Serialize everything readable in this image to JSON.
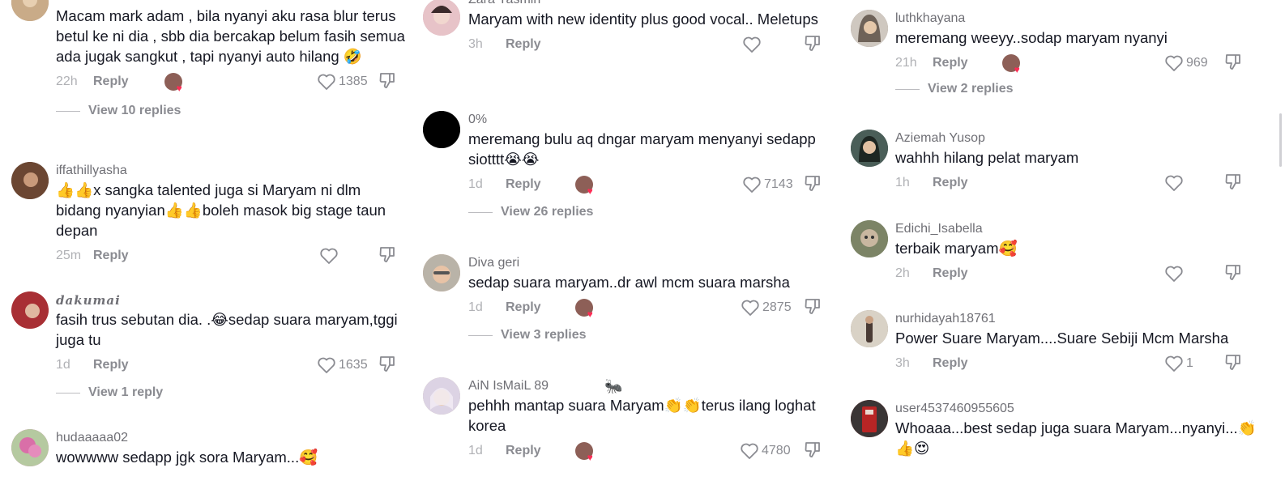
{
  "columns": [
    {
      "comments": [
        {
          "username": "",
          "text": "Macam mark adam , bila nyanyi aku rasa blur terus betul ke ni dia , sbb dia bercakap belum fasih semua ada jugak sangkut , tapi nyanyi auto hilang 🤣",
          "time": "22h",
          "reply": "Reply",
          "likes": "1385",
          "view_replies": "View 10 replies",
          "avatar_color": "#b89a78"
        },
        {
          "username": "iffathillyasha",
          "text": "👍👍x sangka talented juga si Maryam ni dlm bidang nyanyian👍👍boleh masok big stage taun depan",
          "time": "25m",
          "reply": "Reply",
          "likes": "",
          "view_replies": "",
          "avatar_color": "#5a3b2a"
        },
        {
          "username": "dakumai",
          "text": "fasih trus sebutan dia. .😂sedap suara maryam,tggi juga tu",
          "time": "1d",
          "reply": "Reply",
          "likes": "1635",
          "view_replies": "View 1 reply",
          "avatar_color": "#b03a3a"
        },
        {
          "username": "hudaaaaa02",
          "text": "wowwww sedapp jgk sora Maryam...🥰",
          "time": "",
          "reply": "",
          "likes": "",
          "view_replies": "",
          "avatar_color": "#d77fb0"
        }
      ]
    },
    {
      "comments": [
        {
          "username": "Zara Yasmin",
          "text": "Maryam with new identity plus good vocal.. Meletups",
          "time": "3h",
          "reply": "Reply",
          "likes": "",
          "view_replies": "",
          "avatar_color": "#d6a3b0"
        },
        {
          "username": "0%",
          "text": "meremang bulu aq dngar maryam menyanyi sedapp siotttt😭😭",
          "time": "1d",
          "reply": "Reply",
          "likes": "7143",
          "view_replies": "View 26 replies",
          "avatar_color": "#000000"
        },
        {
          "username": "Diva geri",
          "text": "sedap suara maryam..dr awl mcm suara marsha",
          "time": "1d",
          "reply": "Reply",
          "likes": "2875",
          "view_replies": "View 3 replies",
          "avatar_color": "#c9a28a"
        },
        {
          "username": "AiN IsMaiL 89",
          "text": "pehhh mantap suara Maryam👏👏terus ilang loghat korea",
          "time": "1d",
          "reply": "Reply",
          "likes": "4780",
          "view_replies": "",
          "avatar_color": "#c7b9ad",
          "username_emoji": "🐜"
        }
      ]
    },
    {
      "comments": [
        {
          "username": "luthkhayana",
          "text": "meremang weeyy..sodap maryam nyanyi",
          "time": "21h",
          "reply": "Reply",
          "likes": "969",
          "view_replies": "View 2 replies",
          "avatar_color": "#9c8f86"
        },
        {
          "username": "Aziemah Yusop",
          "text": "wahhh hilang pelat maryam",
          "time": "1h",
          "reply": "Reply",
          "likes": "",
          "view_replies": "",
          "avatar_color": "#2f3f3a"
        },
        {
          "username": "Edichi_Isabella",
          "text": "terbaik maryam🥰",
          "time": "2h",
          "reply": "Reply",
          "likes": "",
          "view_replies": "",
          "avatar_color": "#6f7a5a"
        },
        {
          "username": "nurhidayah18761",
          "text": "Power Suare Maryam....Suare Sebiji Mcm Marsha",
          "time": "3h",
          "reply": "Reply",
          "likes": "1",
          "view_replies": "",
          "avatar_color": "#a89c8c"
        },
        {
          "username": "user4537460955605",
          "text": "Whoaaa...best sedap juga suara Maryam...nyanyi...👏👍😍",
          "time": "",
          "reply": "",
          "likes": "",
          "view_replies": "",
          "avatar_color": "#8a2a2a"
        }
      ]
    }
  ],
  "icons": {
    "like": "heart-outline-icon",
    "dislike": "thumbs-down-icon"
  },
  "colors": {
    "text": "#161823",
    "muted": "#8a8b91",
    "heart": "#fe2c55"
  }
}
